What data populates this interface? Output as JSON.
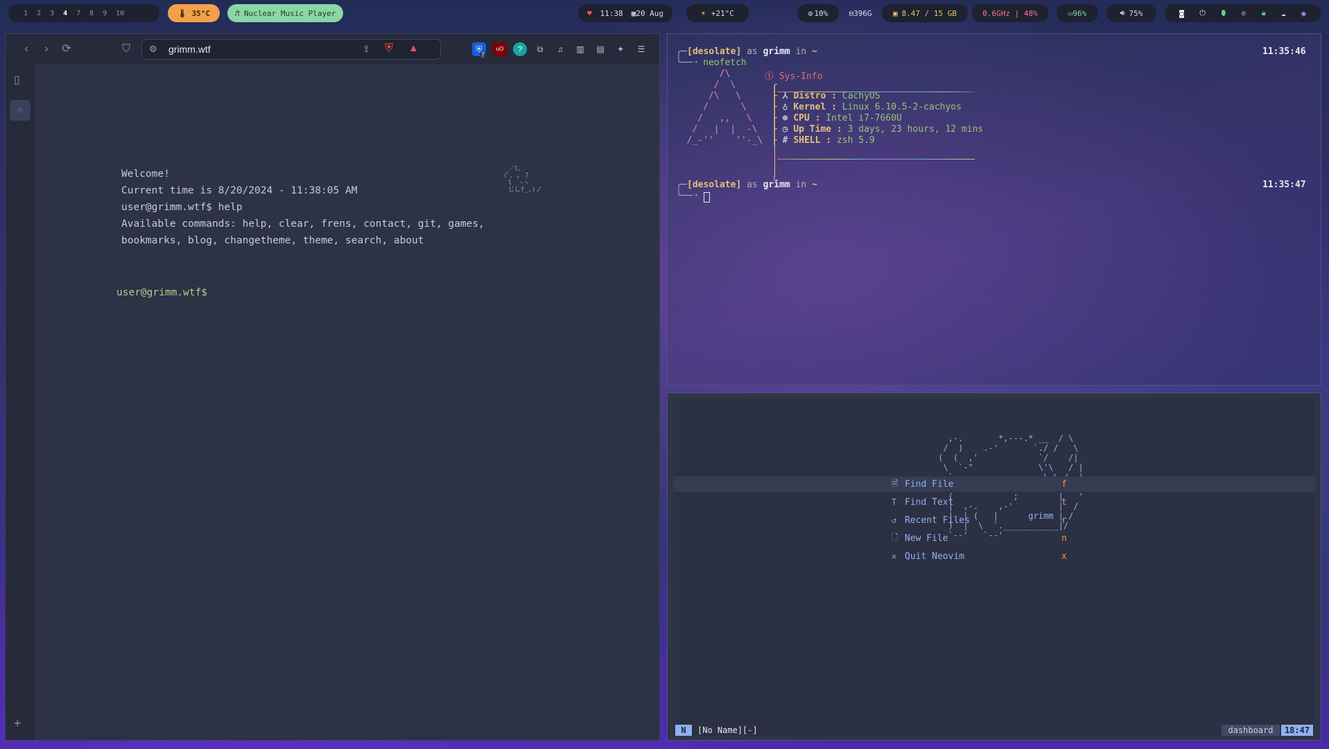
{
  "topbar": {
    "workspaces": [
      "1",
      "2",
      "3",
      "4",
      "7",
      "8",
      "9",
      "10"
    ],
    "current_workspace": "4",
    "temperature": "35°C",
    "music": "Nuclear Music Player",
    "time": "11:38",
    "date": "20 Aug",
    "weather": "+21°C",
    "cpu": "10%",
    "disk": "396G",
    "memory": "8.47 / 15 GB",
    "freq": "0.6GHz | 48%",
    "battery": "96%",
    "volume": "75%"
  },
  "browser": {
    "url": "grimm.wtf",
    "extensions": [
      "bitwarden-icon",
      "ublock-icon",
      "help-icon",
      "puzzle-icon",
      "music-icon",
      "sidebar-icon",
      "wallet-icon",
      "leo-icon",
      "menu-icon"
    ],
    "bitwarden_badge": "7",
    "lines": {
      "welcome": "Welcome!",
      "time": "Current time is 8/20/2024 - 11:38:05 AM",
      "cmd": "user@grimm.wtf$ help",
      "avail1": "Available commands: help, clear, frens, contact, git, games,",
      "avail2": "bookmarks, blog, changetheme, theme, search, about",
      "prompt": "user@grimm.wtf$"
    }
  },
  "terminal": {
    "prompt1": {
      "user": "[desolate]",
      "as": "as",
      "host": "grimm",
      "in": "in",
      "dir": "~",
      "time": "11:35:46",
      "cmd": "neofetch"
    },
    "sysinfo_title": "Sys-Info",
    "info": [
      {
        "icon": "⅄",
        "key": "Distro",
        "value": "CachyOS"
      },
      {
        "icon": "♁",
        "key": "Kernel",
        "value": "Linux 6.10.5-2-cachyos"
      },
      {
        "icon": "⊛",
        "key": "CPU",
        "value": "Intel i7-7660U"
      },
      {
        "icon": "◷",
        "key": "Up Time",
        "value": "3 days, 23 hours, 12 mins"
      },
      {
        "icon": "#",
        "key": "SHELL",
        "value": "zsh 5.9"
      }
    ],
    "prompt2": {
      "user": "[desolate]",
      "as": "as",
      "host": "grimm",
      "in": "in",
      "dir": "~",
      "time": "11:35:47"
    }
  },
  "nvim": {
    "signature": "grimm",
    "menu": [
      {
        "icon": "🗎",
        "label": "Find File",
        "key": "f"
      },
      {
        "icon": "T",
        "label": "Find Text",
        "key": "t"
      },
      {
        "icon": "↺",
        "label": "Recent Files",
        "key": "r"
      },
      {
        "icon": "🗋",
        "label": "New File",
        "key": "n"
      },
      {
        "icon": "✕",
        "label": "Quit Neovim",
        "key": "x"
      }
    ],
    "mode": "N",
    "filename": "[No Name][-]",
    "filetype": "dashboard",
    "clock": "18:47"
  }
}
